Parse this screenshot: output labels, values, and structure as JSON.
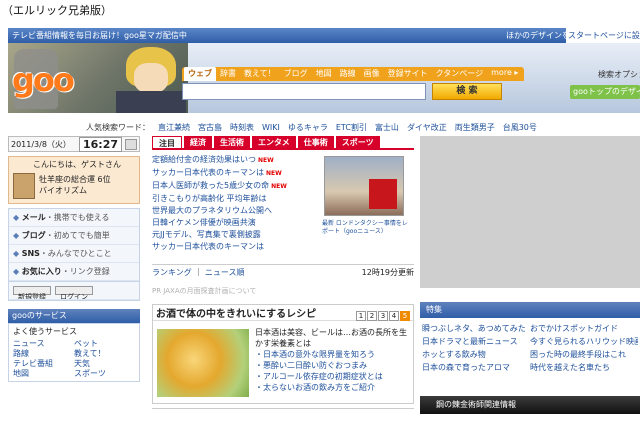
{
  "caption": "（エルリック兄弟版）",
  "topbar": {
    "news": "テレビ番組情報を毎日お届け！goo星マガ配信中",
    "design_label": "ほかのデザインを見る",
    "swatches": [
      {
        "color": "#4aa24a",
        "label": "g"
      },
      {
        "color": "#e0aa00",
        "label": "g"
      },
      {
        "color": "#d23b3b",
        "label": "g"
      },
      {
        "color": "#4a7ed0",
        "label": "g"
      }
    ],
    "start_link": "スタートページに設定"
  },
  "header": {
    "logo": "goo",
    "tabs": [
      "ウェブ",
      "辞書",
      "教えて！",
      "ブログ",
      "地図",
      "路線",
      "画像",
      "登録サイト",
      "クタンページ",
      "more ▸"
    ],
    "search_placeholder": "",
    "search_button": "検 索",
    "right_label": "検索オプショ",
    "goo_top": "gooトップのデザイン"
  },
  "popular": {
    "label": "人気検索ワード：",
    "words": [
      "直江兼続",
      "宮古島",
      "時刻表",
      "WIKI",
      "ゆるキャラ",
      "ETC割引",
      "富士山",
      "ダイヤ改正",
      "両生類男子",
      "台風30号"
    ]
  },
  "left": {
    "date": "2011/3/8（火）",
    "time": "16:27",
    "greeting": "こんにちは、ゲストさん",
    "fortune_line1": "牡羊座の総合運 6位",
    "fortune_line2": "バイオリズム",
    "services": [
      {
        "icon": "mail-icon",
        "name": "メール",
        "desc": "・携帯でも使える"
      },
      {
        "icon": "blog-icon",
        "name": "ブログ",
        "desc": "・初めてでも簡単"
      },
      {
        "icon": "sns-icon",
        "name": "SNS",
        "desc": "・みんなでひとこと"
      },
      {
        "icon": "bookmark-icon",
        "name": "お気に入り",
        "desc": "・リンク登録"
      }
    ],
    "register_button": "新規登録",
    "login_button": "ログイン",
    "fav_header": "gooのサービス",
    "fav_title": "よく使うサービス",
    "fav_items": [
      "ニュース",
      "ペット",
      "路線",
      "教えて！",
      "テレビ番組",
      "天気",
      "地図",
      "スポーツ"
    ]
  },
  "news": {
    "tabs": [
      "注目",
      "経済",
      "生活術",
      "エンタメ",
      "仕事術",
      "スポーツ"
    ],
    "items": [
      {
        "text": "定額給付金の経済効果はいつ",
        "new": true
      },
      {
        "text": "サッカー日本代表のキーマンは",
        "new": true
      },
      {
        "text": "日本人医師が救った5歳少女の命",
        "new": true
      },
      {
        "text": "引きこもりが高齢化 平均年齢は",
        "new": false
      },
      {
        "text": "世界最大のプラネタリウム公開へ",
        "new": false
      },
      {
        "text": "日韓イケメン俳優が映画共演",
        "new": false
      },
      {
        "text": "元JJモデル、写真集で裏側披露",
        "new": false
      },
      {
        "text": "サッカー日本代表のキーマンは",
        "new": false
      }
    ],
    "new_badge": "NEW",
    "photo_caption": "最新 ロンドンタクシー事情をレポート（gooニュース）",
    "footer_ranking": "ランキング",
    "footer_news": "ニュース順",
    "updated": "12時19分更新"
  },
  "promo_text": "PR  JAXAの月面探査計画について",
  "sake": {
    "title": "お酒で体の中をきれいにするレシピ",
    "pages": [
      "1",
      "2",
      "3",
      "4",
      "5"
    ],
    "current_page": 5,
    "lead": "日本酒は美容、ビールは…お酒の長所を生かす栄養素とは",
    "links": [
      "・日本酒の意外な限界量を知ろう",
      "・悪酔い二日酔い防ぐおつまみ",
      "・アルコール依存症の初期症状とは",
      "・太らないお酒の飲み方をご紹介"
    ]
  },
  "feature": {
    "header": "特集",
    "items": [
      "瞬つぶしネタ、あつめてみた",
      "おでかけスポットガイド",
      "日本ドラマと最新ニュース",
      "今すぐ見られるハリウッド映画",
      "ホッとする飲み物",
      "困った時の最終手段はこれ",
      "日本の森で育ったアロマ",
      "時代を越えた名車たち"
    ]
  },
  "fma_bar": "鋼の錬金術師関連情報"
}
